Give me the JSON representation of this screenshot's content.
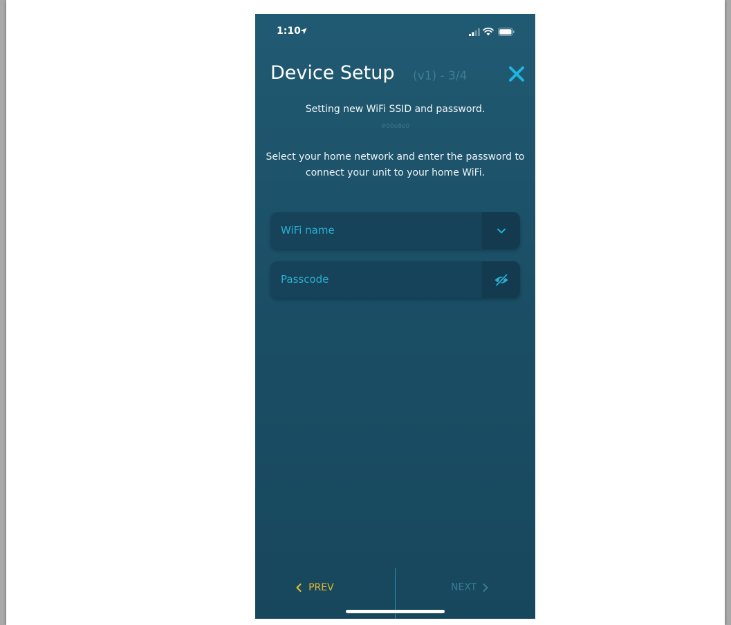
{
  "status_bar": {
    "time": "1:10"
  },
  "header": {
    "title": "Device Setup",
    "step_suffix": "(v1) - 3/4",
    "close_icon": "close-icon"
  },
  "content": {
    "subtitle": "Setting new WiFi SSID and password.",
    "device_id": "#00e8e0",
    "instructions": "Select your home network and enter the password to connect your unit to your home WiFi."
  },
  "form": {
    "wifi_field": {
      "placeholder": "WiFi name",
      "icon": "chevron-down-icon"
    },
    "passcode_field": {
      "placeholder": "Passcode",
      "icon": "eye-slash-icon"
    }
  },
  "nav": {
    "prev_label": "PREV",
    "next_label": "NEXT"
  },
  "colors": {
    "background_top": "#205a72",
    "background_bottom": "#17475d",
    "accent_cyan": "#2aaed0",
    "prev_yellow": "#e2b92e",
    "disabled_text": "#3b7a95"
  }
}
